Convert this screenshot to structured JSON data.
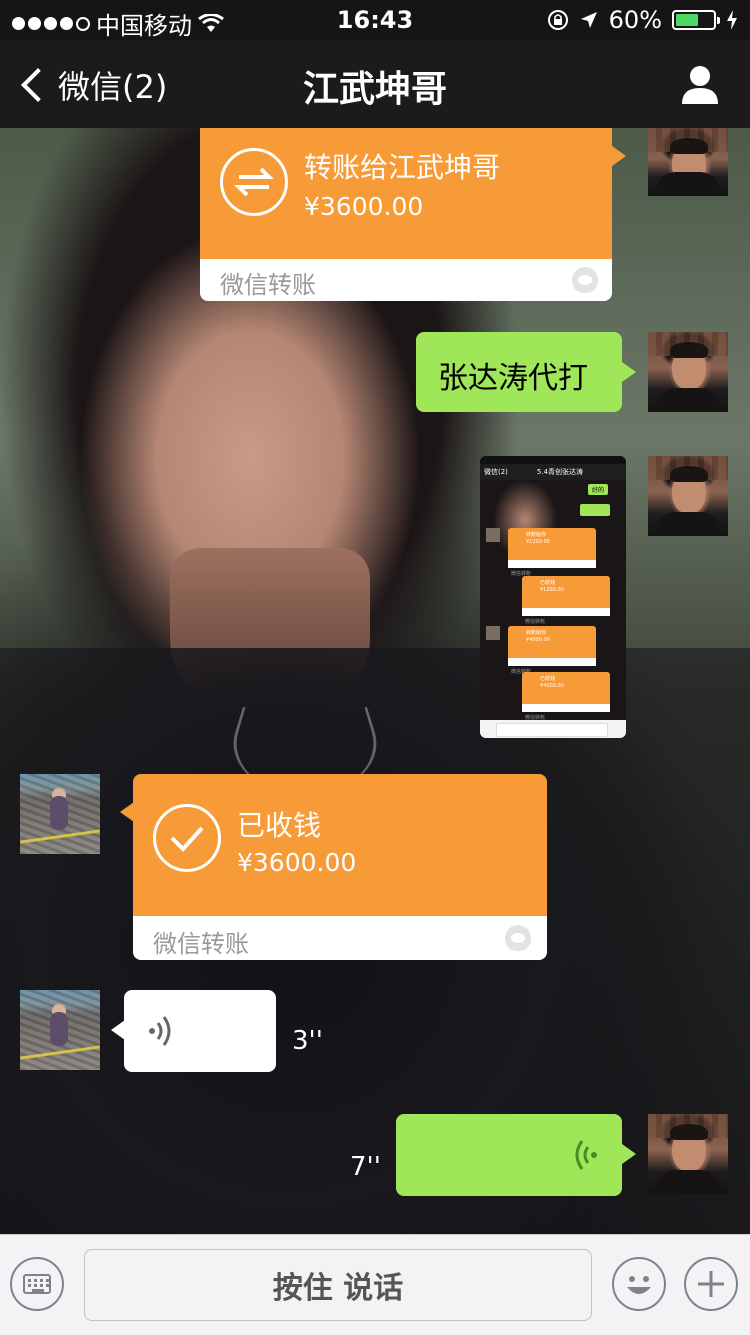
{
  "status_bar": {
    "carrier": "中国移动",
    "time": "16:43",
    "battery_percent": "60%",
    "battery_level": 0.6,
    "signal_dots_filled": 4
  },
  "nav": {
    "back_label": "微信(2)",
    "title": "江武坤哥",
    "profile_icon": "person-icon"
  },
  "messages": {
    "transfer_sent": {
      "title": "转账给江武坤哥",
      "amount": "¥3600.00",
      "footer": "微信转账"
    },
    "text_sent": {
      "text": "张达涛代打"
    },
    "image_sent": {
      "nav_back": "微信(2)",
      "nav_title": "5.4青创张达涛",
      "reply_ok": "好的",
      "cards": [
        {
          "title": "转账给你",
          "amount": "¥1200.00",
          "footer": "微信转账"
        },
        {
          "title": "已收钱",
          "amount": "¥1200.00",
          "footer": "微信转账"
        },
        {
          "title": "转账给你",
          "amount": "¥4000.00",
          "footer": "微信转账"
        },
        {
          "title": "已收钱",
          "amount": "¥4000.00",
          "footer": "微信转账"
        }
      ]
    },
    "transfer_received": {
      "title": "已收钱",
      "amount": "¥3600.00",
      "footer": "微信转账"
    },
    "voice_received": {
      "duration": "3''"
    },
    "voice_sent": {
      "duration": "7''"
    }
  },
  "toolbar": {
    "hold_to_talk": "按住 说话",
    "keyboard_icon": "keyboard-icon",
    "emoji_icon": "emoji-icon",
    "plus_icon": "plus-icon"
  },
  "colors": {
    "transfer_orange": "#f79b39",
    "bubble_green": "#9fe658",
    "bar_dark": "#1b1b1b",
    "toolbar_bg": "#f3f3f5"
  }
}
